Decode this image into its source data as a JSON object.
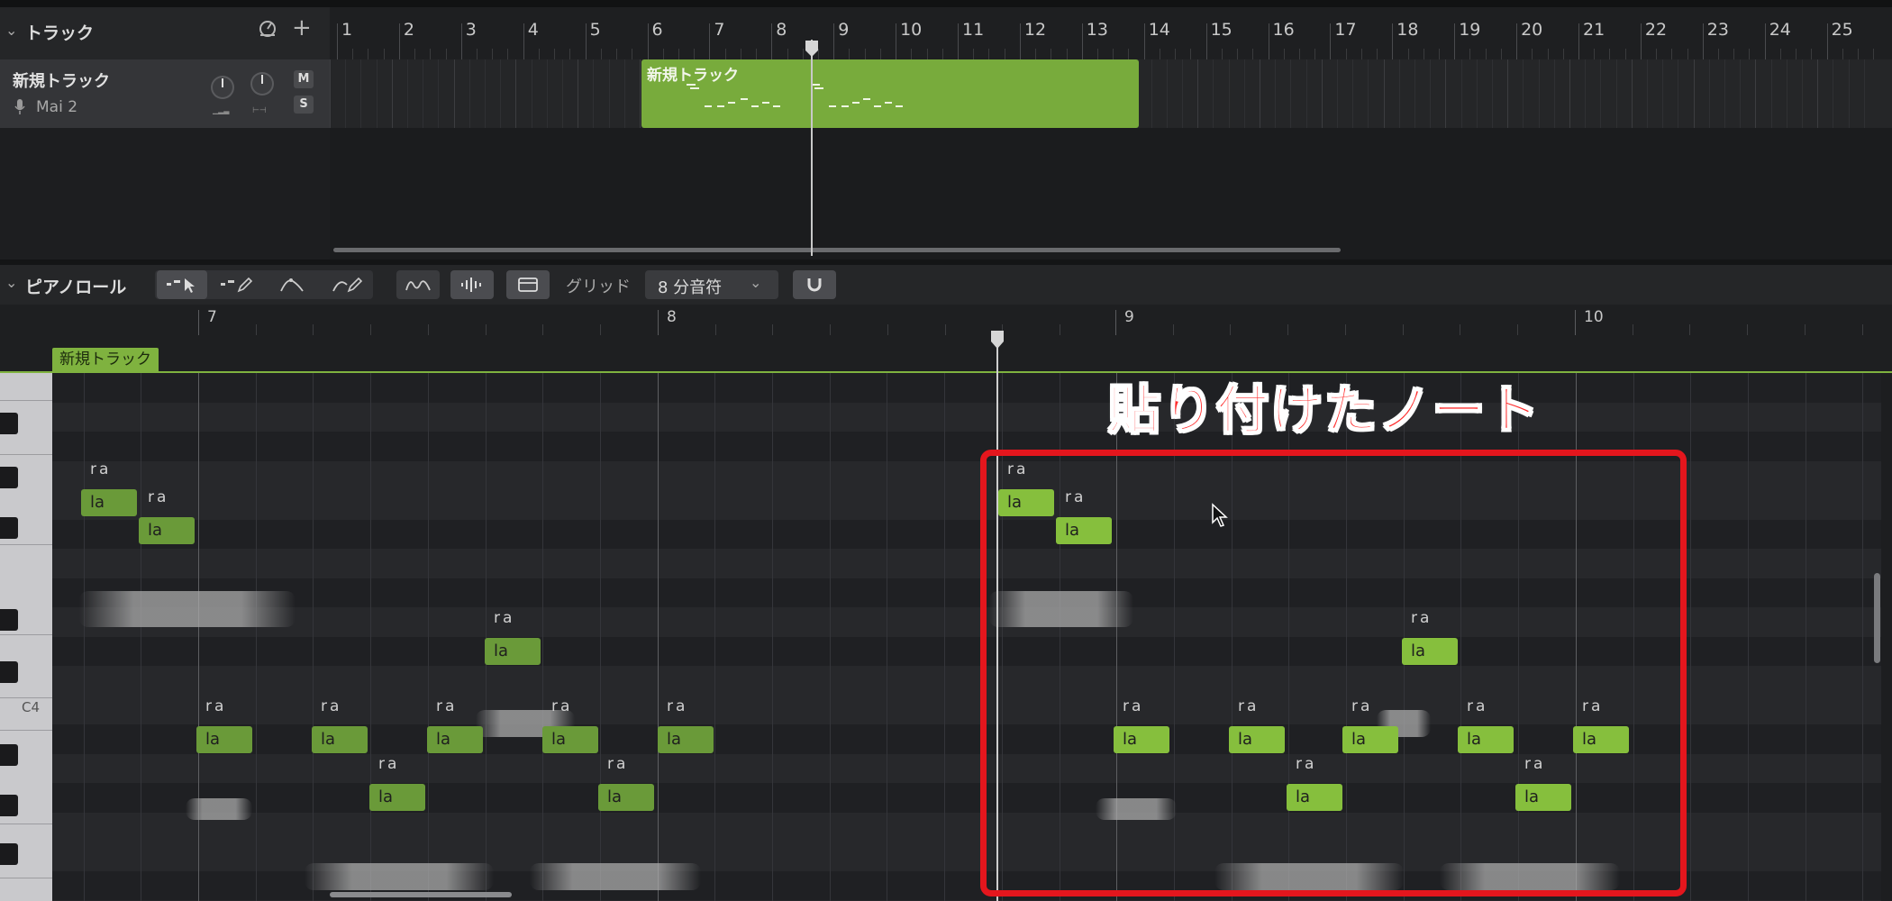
{
  "tracks_panel": {
    "title": "トラック"
  },
  "track": {
    "name": "新規トラック",
    "voice": "Mai 2",
    "mute": "M",
    "solo": "S"
  },
  "region": {
    "name": "新規トラック"
  },
  "top_ruler": [
    "1",
    "2",
    "3",
    "4",
    "5",
    "6",
    "7",
    "8",
    "9",
    "10",
    "11",
    "12",
    "13",
    "14",
    "15",
    "16",
    "17",
    "18",
    "19",
    "20",
    "21",
    "22",
    "23",
    "24",
    "25"
  ],
  "piano_roll": {
    "title": "ピアノロール",
    "grid_label": "グリッド",
    "grid_value": "8 分音符",
    "ruler": [
      "7",
      "8",
      "9",
      "10"
    ],
    "region_tag": "新規トラック",
    "c4_label": "C4"
  },
  "note": {
    "lyric": "la",
    "phoneme": "ra"
  },
  "annotation": "貼り付けたノート",
  "colors": {
    "note_original": "#6a9a39",
    "note_pasted": "#86bf3d",
    "highlight": "#e4161d"
  }
}
